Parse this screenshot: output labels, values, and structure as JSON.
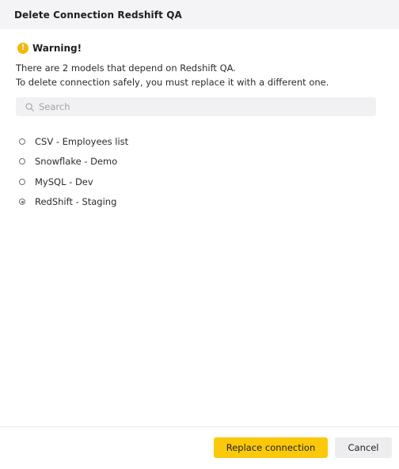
{
  "dialog": {
    "title": "Delete Connection Redshift QA"
  },
  "warning": {
    "icon": "exclamation-icon",
    "icon_glyph": "!",
    "title": "Warning!",
    "message_line1": "There are 2 models that depend on Redshift QA.",
    "message_line2": "To delete connection safely, you must replace it with a different one.",
    "accent_color": "#f5b800"
  },
  "search": {
    "placeholder": "Search",
    "value": ""
  },
  "connections": [
    {
      "label": "CSV - Employees list",
      "selected": false
    },
    {
      "label": "Snowflake - Demo",
      "selected": false
    },
    {
      "label": "MySQL - Dev",
      "selected": false
    },
    {
      "label": "RedShift - Staging",
      "selected": true
    }
  ],
  "footer": {
    "replace_label": "Replace connection",
    "cancel_label": "Cancel",
    "primary_color": "#fcc80a"
  }
}
